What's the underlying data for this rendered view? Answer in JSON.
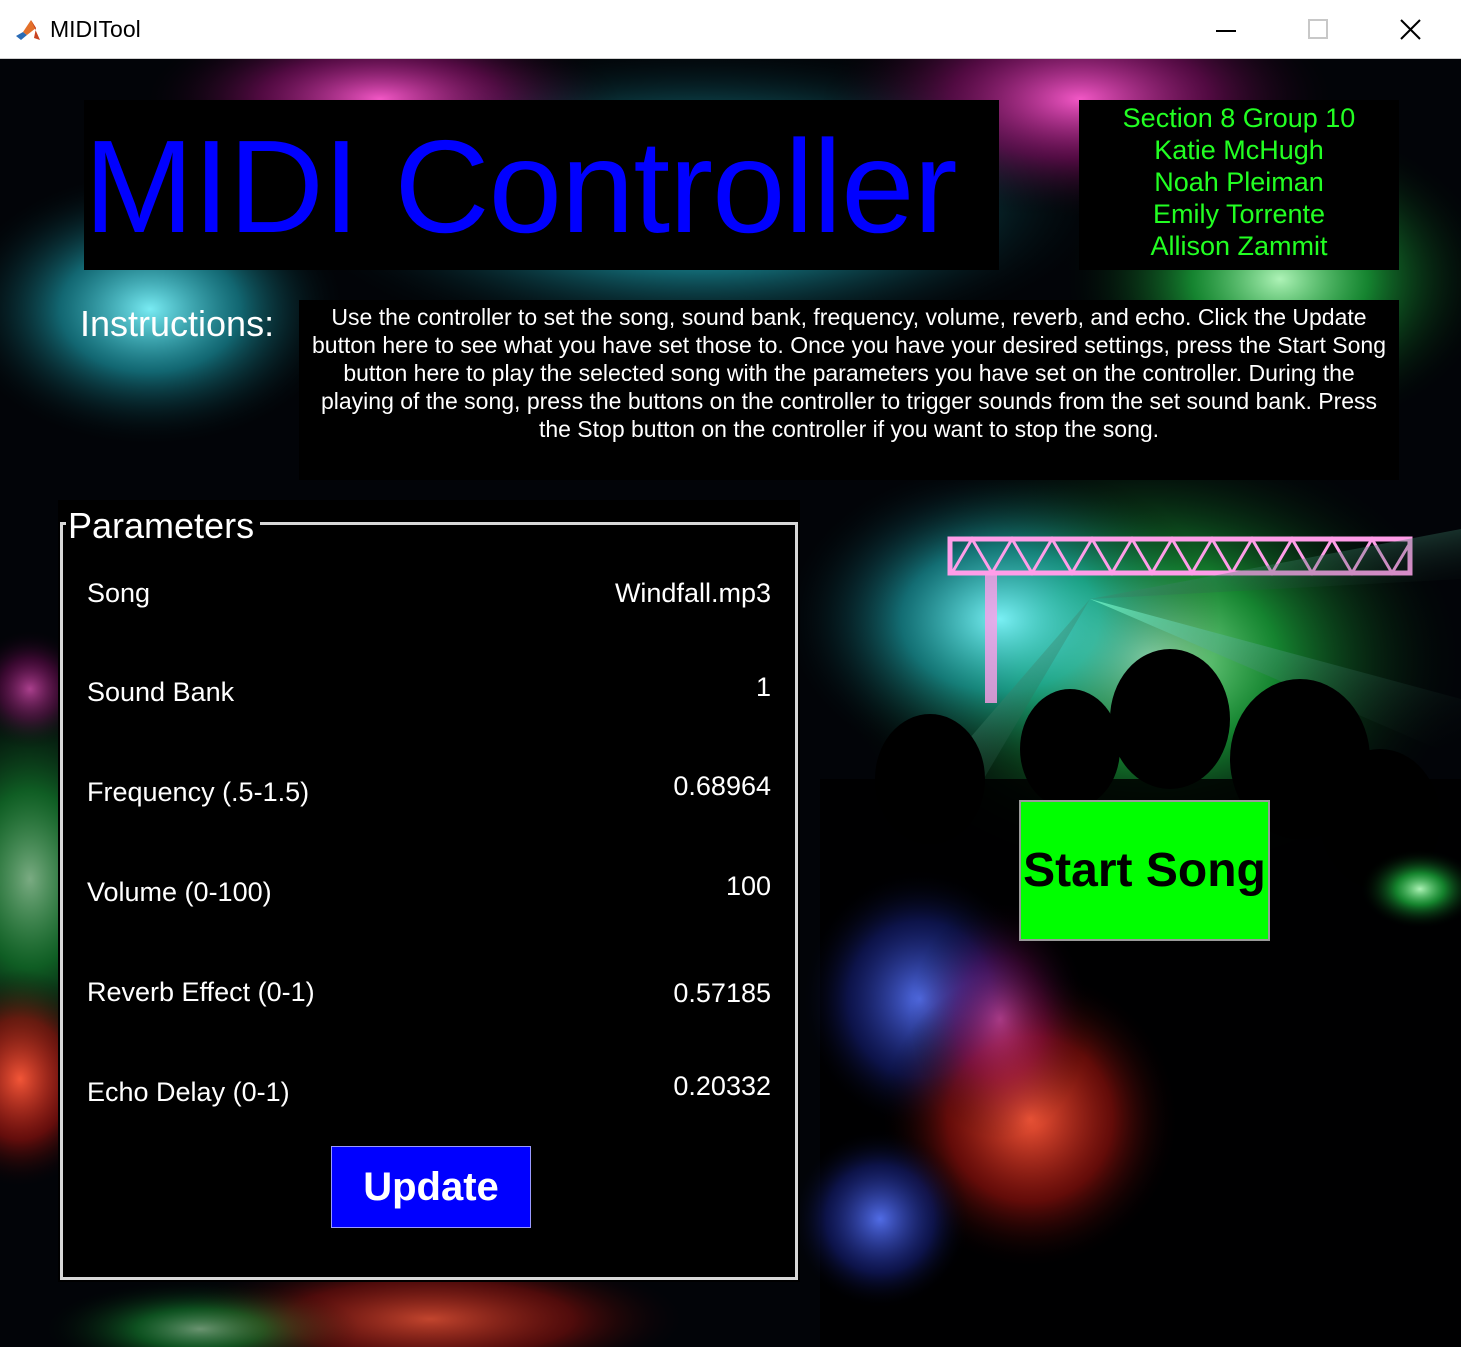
{
  "window": {
    "title": "MIDITool",
    "controls": [
      "minimize-icon",
      "maximize-icon",
      "close-icon"
    ]
  },
  "header": {
    "title": "MIDI Controller",
    "title_color": "#0000ff",
    "credits": [
      "Section 8 Group 10",
      "Katie McHugh",
      "Noah Pleiman",
      "Emily Torrente",
      "Allison Zammit"
    ],
    "credits_color": "#22ff22"
  },
  "instructions": {
    "label": "Instructions:",
    "text": "Use the controller to set the song, sound bank, frequency, volume, reverb, and echo. Click the Update button here to see what you have set those to. Once you have your desired settings, press the Start Song button here to play the selected song with the parameters you have set on the controller. During the playing of the song, press the buttons on the controller to trigger sounds from the set sound bank. Press the Stop button on the controller if you want to stop the song."
  },
  "parameters": {
    "title": "Parameters",
    "rows": [
      {
        "label": "Song",
        "value": "Windfall.mp3"
      },
      {
        "label": "Sound Bank",
        "value": "1"
      },
      {
        "label": "Frequency (.5-1.5)",
        "value": "0.68964"
      },
      {
        "label": "Volume (0-100)",
        "value": "100"
      },
      {
        "label": "Reverb Effect (0-1)",
        "value": "0.57185"
      },
      {
        "label": "Echo Delay (0-1)",
        "value": "0.20332"
      }
    ],
    "update_label": "Update",
    "update_color": "#0000ff"
  },
  "start": {
    "label": "Start Song",
    "color": "#00ff00"
  }
}
